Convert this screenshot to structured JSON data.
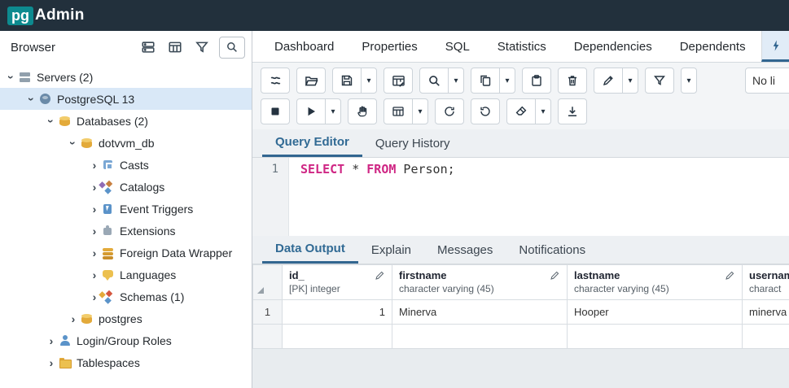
{
  "header": {
    "logo_pg": "pg",
    "logo_admin": "Admin"
  },
  "colors": {
    "header_bg": "#22303c",
    "logo_teal": "#0d8a8f",
    "accent_blue": "#326690",
    "tree_selection": "#d9e8f7",
    "sql_keyword": "#cf2684"
  },
  "icons": {
    "chevron": "›",
    "dropdown": "▾"
  },
  "browser": {
    "title": "Browser",
    "toolbar_icons": [
      "quick-server-icon",
      "table-icon",
      "filter-icon",
      "search-icon"
    ],
    "tree": [
      {
        "label": "Servers (2)",
        "level": 0,
        "state": "expanded",
        "icon": "servers-icon"
      },
      {
        "label": "PostgreSQL 13",
        "level": 1,
        "state": "expanded",
        "icon": "postgresql-icon",
        "selected": true
      },
      {
        "label": "Databases (2)",
        "level": 2,
        "state": "expanded",
        "icon": "databases-icon"
      },
      {
        "label": "dotvvm_db",
        "level": 3,
        "state": "expanded",
        "icon": "database-icon"
      },
      {
        "label": "Casts",
        "level": 4,
        "state": "collapsed",
        "icon": "casts-icon"
      },
      {
        "label": "Catalogs",
        "level": 4,
        "state": "collapsed",
        "icon": "catalogs-icon"
      },
      {
        "label": "Event Triggers",
        "level": 4,
        "state": "collapsed",
        "icon": "event-triggers-icon"
      },
      {
        "label": "Extensions",
        "level": 4,
        "state": "collapsed",
        "icon": "extensions-icon"
      },
      {
        "label": "Foreign Data Wrapper",
        "level": 4,
        "state": "collapsed",
        "icon": "foreign-data-wrapper-icon"
      },
      {
        "label": "Languages",
        "level": 4,
        "state": "collapsed",
        "icon": "languages-icon"
      },
      {
        "label": "Schemas (1)",
        "level": 4,
        "state": "collapsed",
        "icon": "schemas-icon"
      },
      {
        "label": "postgres",
        "level": 3,
        "state": "collapsed",
        "icon": "database-icon"
      },
      {
        "label": "Login/Group Roles",
        "level": 2,
        "state": "collapsed",
        "icon": "login-group-roles-icon"
      },
      {
        "label": "Tablespaces",
        "level": 2,
        "state": "collapsed",
        "icon": "tablespaces-icon"
      }
    ]
  },
  "main_tabs": {
    "items": [
      "Dashboard",
      "Properties",
      "SQL",
      "Statistics",
      "Dependencies",
      "Dependents"
    ],
    "partial_active_tab_icon": "query-tool-icon"
  },
  "toolbar_row1": {
    "buttons": [
      "connection-icon",
      "open-file-icon",
      "save-icon",
      "save-menu",
      "edit-grid-icon",
      "find-icon",
      "find-menu",
      "copy-icon",
      "copy-menu",
      "paste-icon",
      "delete-icon",
      "edit-icon",
      "edit-menu",
      "filter-icon",
      "filter-menu"
    ],
    "limit_value": "No li"
  },
  "toolbar_row2": {
    "buttons": [
      "cancel-icon",
      "execute-icon",
      "execute-menu",
      "explain-icon",
      "explain-grid-icon",
      "explain-menu",
      "commit-icon",
      "rollback-icon",
      "clear-icon",
      "clear-menu",
      "download-csv-icon"
    ]
  },
  "query_tabs": {
    "items": [
      {
        "label": "Query Editor",
        "active": true
      },
      {
        "label": "Query History",
        "active": false
      }
    ]
  },
  "editor": {
    "line_number": "1",
    "sql_text": "SELECT * FROM Person;",
    "tokens": [
      {
        "text": "SELECT",
        "type": "keyword"
      },
      {
        "text": " * ",
        "type": "plain"
      },
      {
        "text": "FROM",
        "type": "keyword"
      },
      {
        "text": " Person;",
        "type": "plain"
      }
    ]
  },
  "output_tabs": {
    "items": [
      {
        "label": "Data Output",
        "active": true
      },
      {
        "label": "Explain",
        "active": false
      },
      {
        "label": "Messages",
        "active": false
      },
      {
        "label": "Notifications",
        "active": false
      }
    ]
  },
  "grid": {
    "columns": [
      {
        "name": "id_",
        "type": "[PK] integer"
      },
      {
        "name": "firstname",
        "type": "character varying (45)"
      },
      {
        "name": "lastname",
        "type": "character varying (45)"
      },
      {
        "name": "usernam",
        "type": "charact"
      }
    ],
    "rows": [
      {
        "num": "1",
        "cells": [
          "1",
          "Minerva",
          "Hooper",
          "minerva"
        ]
      },
      {
        "num": "",
        "cells": [
          "",
          "",
          "",
          ""
        ]
      }
    ]
  }
}
